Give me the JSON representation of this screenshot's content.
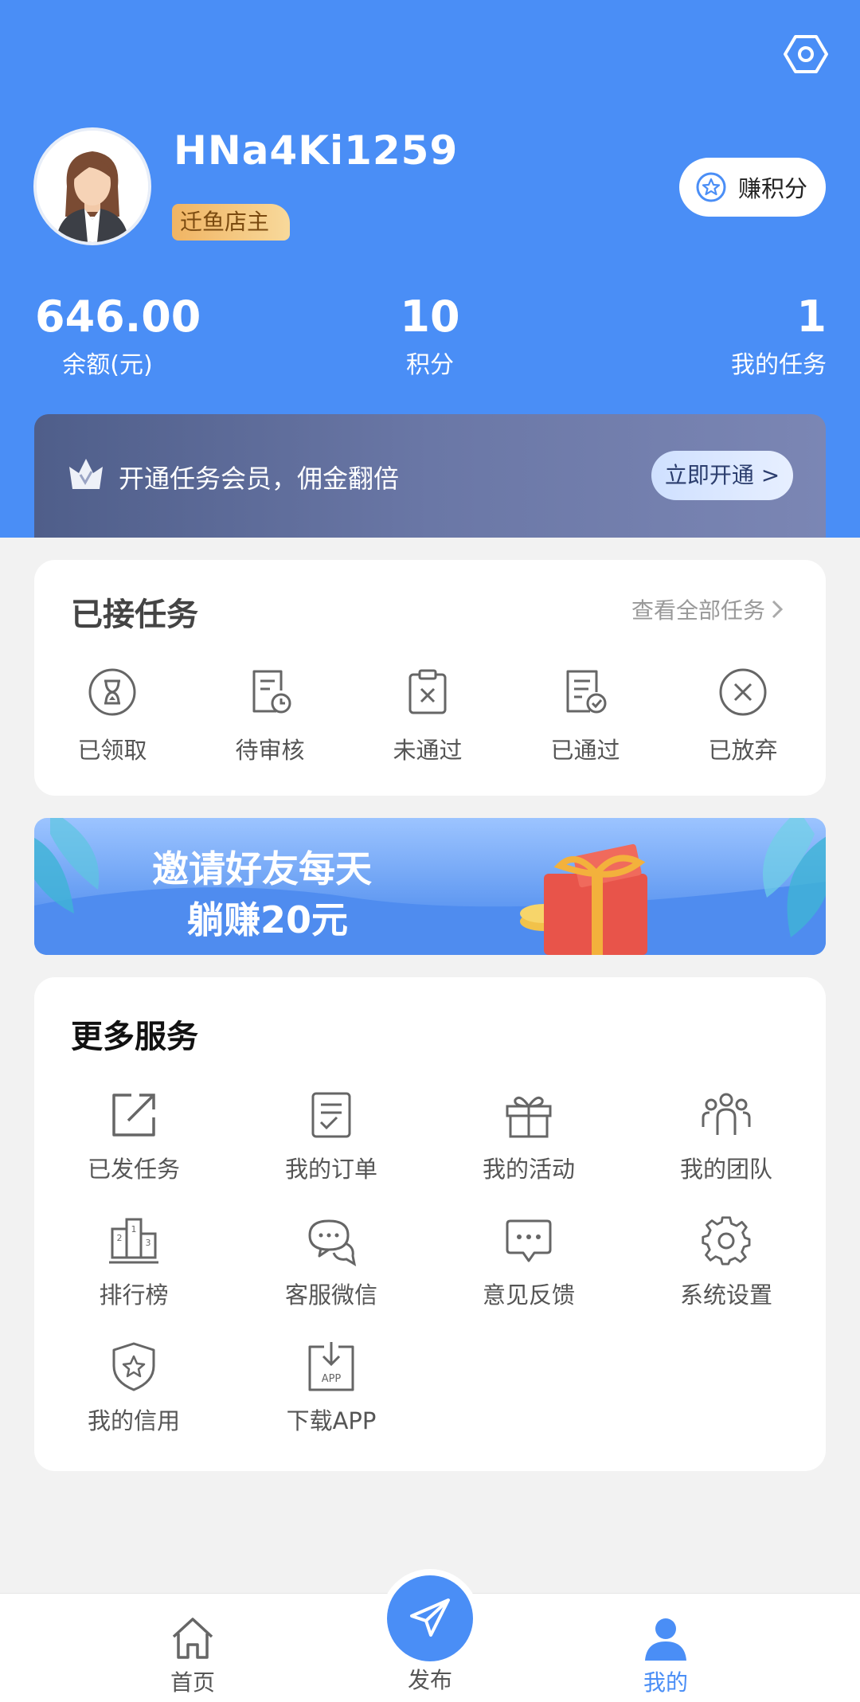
{
  "user": {
    "name": "HNa4Ki1259",
    "role": "迁鱼店主",
    "earn_points_label": "赚积分"
  },
  "stats": [
    {
      "value": "646.00",
      "label": "余额(元)"
    },
    {
      "value": "10",
      "label": "积分"
    },
    {
      "value": "1",
      "label": "我的任务"
    }
  ],
  "vip": {
    "text": "开通任务会员，佣金翻倍",
    "button": "立即开通 >"
  },
  "accepted_tasks": {
    "title": "已接任务",
    "view_all": "查看全部任务",
    "items": [
      {
        "label": "已领取",
        "icon": "hourglass-icon"
      },
      {
        "label": "待审核",
        "icon": "pending-review-icon"
      },
      {
        "label": "未通过",
        "icon": "rejected-clipboard-icon"
      },
      {
        "label": "已通过",
        "icon": "approved-document-icon"
      },
      {
        "label": "已放弃",
        "icon": "close-circle-icon"
      }
    ]
  },
  "invite_banner": {
    "line1": "邀请好友每天",
    "line2": "躺赚20元"
  },
  "services": {
    "title": "更多服务",
    "items": [
      {
        "label": "已发任务",
        "icon": "external-link-icon"
      },
      {
        "label": "我的订单",
        "icon": "order-icon"
      },
      {
        "label": "我的活动",
        "icon": "gift-icon"
      },
      {
        "label": "我的团队",
        "icon": "team-icon"
      },
      {
        "label": "排行榜",
        "icon": "podium-icon"
      },
      {
        "label": "客服微信",
        "icon": "chat-icon"
      },
      {
        "label": "意见反馈",
        "icon": "feedback-icon"
      },
      {
        "label": "系统设置",
        "icon": "gear-icon"
      },
      {
        "label": "我的信用",
        "icon": "shield-star-icon"
      },
      {
        "label": "下载APP",
        "icon": "download-app-icon"
      }
    ]
  },
  "download_icon_text": "APP",
  "tabbar": [
    {
      "label": "首页",
      "icon": "home-icon"
    },
    {
      "label": "发布",
      "icon": "send-icon"
    },
    {
      "label": "我的",
      "icon": "profile-icon",
      "active": true
    }
  ],
  "colors": {
    "primary": "#4a8ef6",
    "badge": "#f0b463",
    "vip": "#5a6894"
  }
}
